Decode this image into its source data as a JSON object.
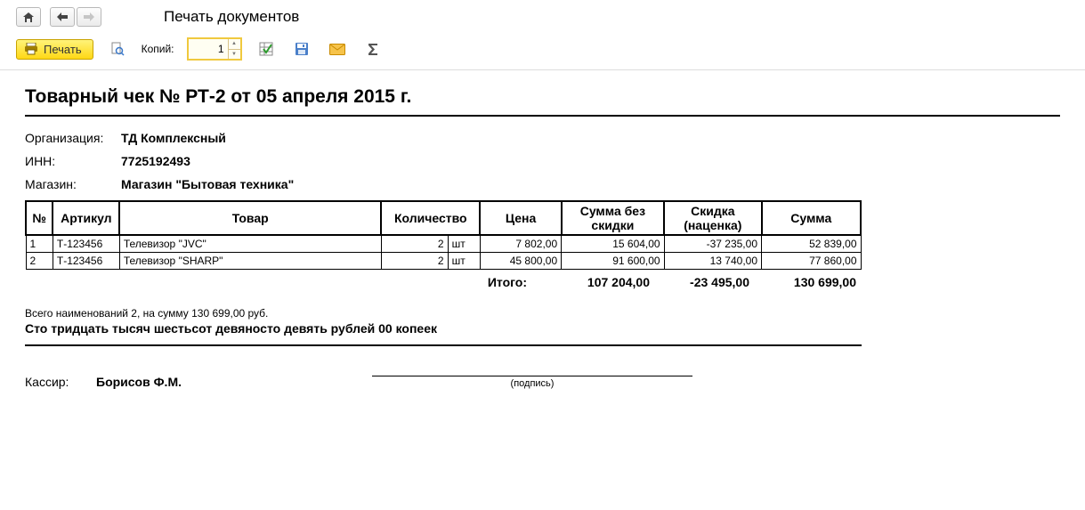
{
  "header": {
    "title": "Печать документов"
  },
  "toolbar": {
    "print_label": "Печать",
    "copies_label": "Копий:",
    "copies_value": "1"
  },
  "doc": {
    "title": "Товарный чек № РТ-2 от 05 апреля 2015 г.",
    "org_label": "Организация:",
    "org_value": "ТД Комплексный",
    "inn_label": "ИНН:",
    "inn_value": "7725192493",
    "store_label": "Магазин:",
    "store_value": "Магазин \"Бытовая техника\""
  },
  "columns": {
    "n": "№",
    "art": "Артикул",
    "goods": "Товар",
    "qty": "Количество",
    "price": "Цена",
    "sum_no_disc": "Сумма без скидки",
    "discount": "Скидка (наценка)",
    "sum": "Сумма"
  },
  "rows": [
    {
      "n": "1",
      "art": "Т-123456",
      "goods": "Телевизор \"JVC\"",
      "qty": "2",
      "unit": "шт",
      "price": "7 802,00",
      "sum_no_disc": "15 604,00",
      "discount": "-37 235,00",
      "sum": "52 839,00"
    },
    {
      "n": "2",
      "art": "Т-123456",
      "goods": "Телевизор \"SHARP\"",
      "qty": "2",
      "unit": "шт",
      "price": "45 800,00",
      "sum_no_disc": "91 600,00",
      "discount": "13 740,00",
      "sum": "77 860,00"
    }
  ],
  "totals": {
    "label": "Итого:",
    "sum_no_disc": "107 204,00",
    "discount": "-23 495,00",
    "sum": "130 699,00"
  },
  "summary": {
    "count_line": "Всего наименований 2, на сумму 130 699,00 руб.",
    "words": "Сто тридцать тысяч шестьсот девяносто девять рублей 00 копеек"
  },
  "sign": {
    "label": "Кассир:",
    "name": "Борисов Ф.М.",
    "caption": "(подпись)"
  }
}
